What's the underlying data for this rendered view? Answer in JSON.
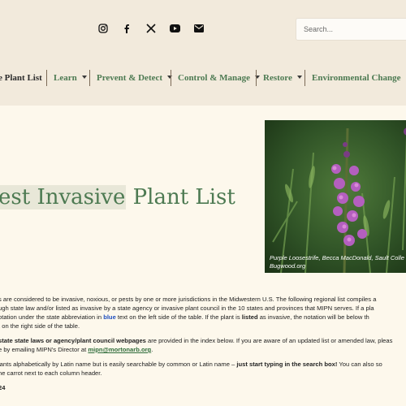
{
  "header": {
    "social": [
      {
        "icon": "instagram-icon"
      },
      {
        "icon": "facebook-icon"
      },
      {
        "icon": "x-icon"
      },
      {
        "icon": "youtube-icon"
      },
      {
        "icon": "email-icon"
      }
    ],
    "search": {
      "placeholder": "Search..."
    }
  },
  "nav": {
    "brand": "e Plant List",
    "items": [
      {
        "label": "Learn"
      },
      {
        "label": "Prevent & Detect"
      },
      {
        "label": "Control & Manage"
      },
      {
        "label": "Restore"
      },
      {
        "label": "Environmental Change"
      }
    ]
  },
  "page": {
    "title_highlight": "est Invasive",
    "title_rest": " Plant List"
  },
  "photo": {
    "caption_line1": "Purple Loosestrife, Becca MacDonald, Sault Colle",
    "caption_line2": "Bugwood.org"
  },
  "intro": {
    "p1_line1": "s are considered to be invasive, noxious, or pests by one or more jurisdictions in the Midwestern U.S. The following regional list compiles a",
    "p1_line2": "ugh state law  and/or listed as invasive by a state agency or invasive plant council in the 10 states and provinces that MIPN serves. If a pla",
    "p1_line3a": "otation under the state abbreviation in ",
    "p1_line3_blue": "blue",
    "p1_line3b": " text on the left side of the table. If the plant is ",
    "p1_line3_bold": "listed",
    "p1_line3c": " as invasive, the notation will be below th",
    "p1_line4": "t on the right side of the table.",
    "p2_line1_bold": "state state laws or agency/plant council webpages",
    "p2_line1_rest": " are provided in the index below. If you are aware of an updated list or amended law, pleas",
    "p2_line2a": "e by emailing MIPN's Director at ",
    "p2_email": "mipn@mortonarb.org",
    "p2_line2b": ".",
    "p3_line1a": "lants alphabetically by Latin name but is easily searchable by common or Latin name – ",
    "p3_line1_bold": "just start typing in the search box!",
    "p3_line1b": " You can also so",
    "p3_line2": "he carrot next to each column header.",
    "date_fragment": "24"
  },
  "colors": {
    "header_bg": "#f2eadc",
    "page_bg": "#fdf8ec",
    "accent_green": "#4d7a52",
    "link_green": "#2f6c3a",
    "highlight_blue": "#1f4fbf"
  }
}
